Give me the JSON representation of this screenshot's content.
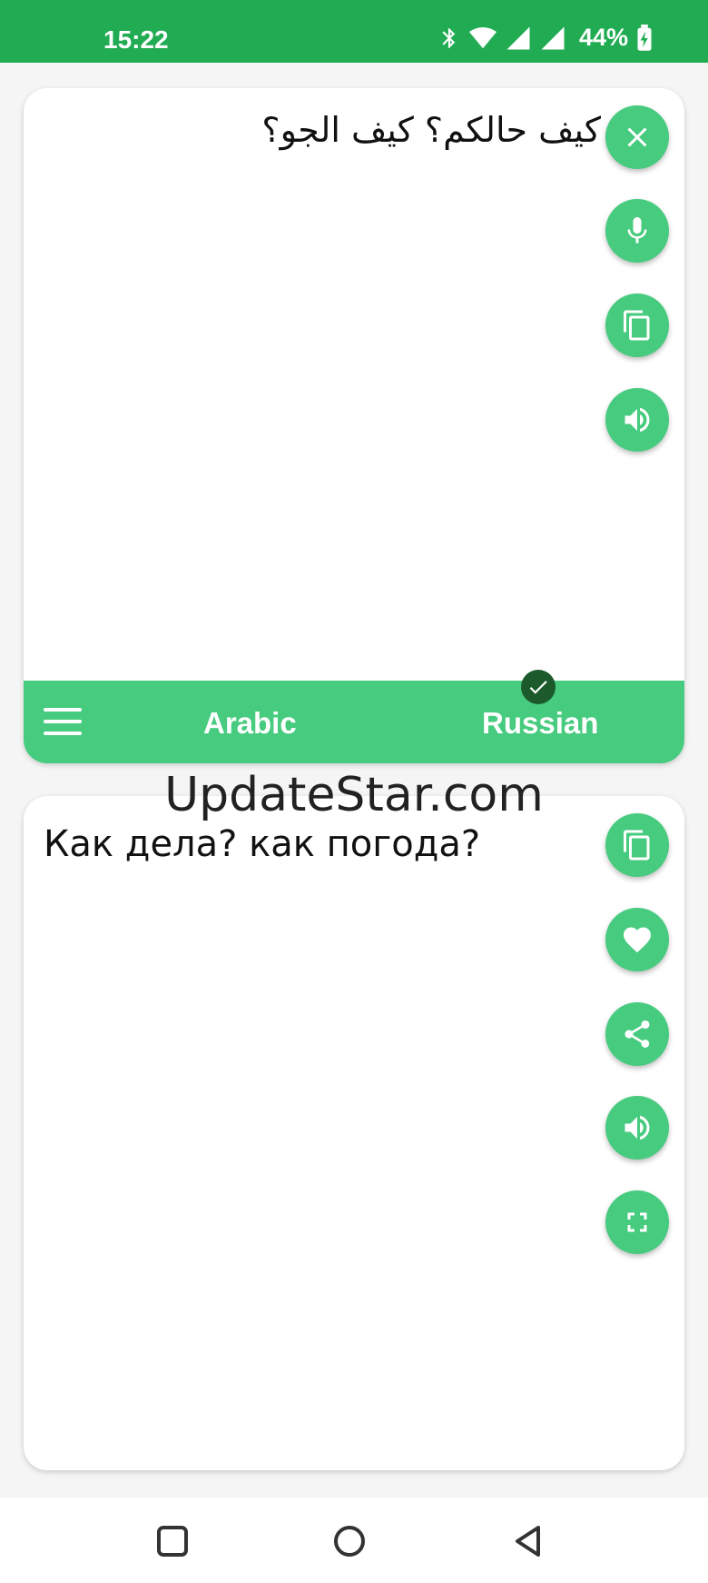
{
  "status_bar": {
    "time": "15:22",
    "battery": "44%"
  },
  "source": {
    "text": "كيف حالكم؟ كيف الجو؟"
  },
  "language_bar": {
    "source_language": "Arabic",
    "target_language": "Russian"
  },
  "target": {
    "text": "Как дела? как погода?"
  },
  "watermark": "UpdateStar.com",
  "colors": {
    "status_bar": "#21ac53",
    "accent": "#47cb7f",
    "check_badge": "#1c5a2c"
  },
  "icons": {
    "source_actions": [
      "close-icon",
      "microphone-icon",
      "copy-icon",
      "speaker-icon"
    ],
    "target_actions": [
      "copy-icon",
      "heart-icon",
      "share-icon",
      "speaker-icon",
      "fullscreen-icon"
    ],
    "navigation": [
      "recent-apps-icon",
      "home-icon",
      "back-icon"
    ]
  }
}
